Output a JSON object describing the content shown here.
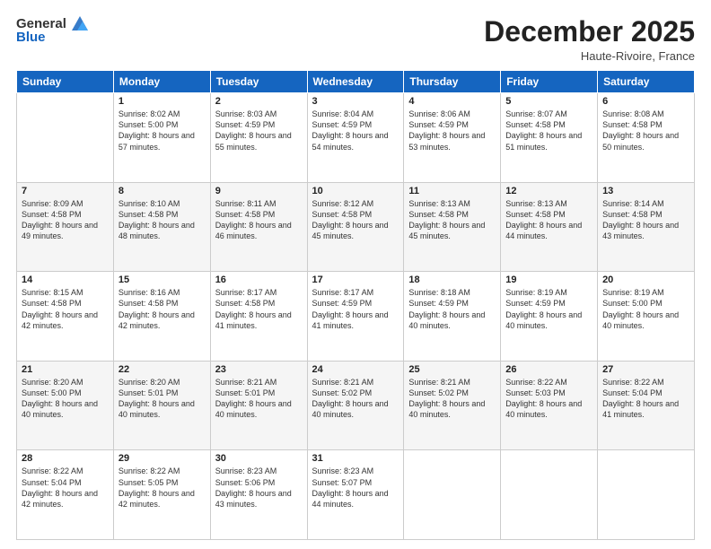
{
  "header": {
    "logo_general": "General",
    "logo_blue": "Blue",
    "month_title": "December 2025",
    "location": "Haute-Rivoire, France"
  },
  "weekdays": [
    "Sunday",
    "Monday",
    "Tuesday",
    "Wednesday",
    "Thursday",
    "Friday",
    "Saturday"
  ],
  "weeks": [
    [
      {
        "day": "",
        "sunrise": "",
        "sunset": "",
        "daylight": ""
      },
      {
        "day": "1",
        "sunrise": "Sunrise: 8:02 AM",
        "sunset": "Sunset: 5:00 PM",
        "daylight": "Daylight: 8 hours and 57 minutes."
      },
      {
        "day": "2",
        "sunrise": "Sunrise: 8:03 AM",
        "sunset": "Sunset: 4:59 PM",
        "daylight": "Daylight: 8 hours and 55 minutes."
      },
      {
        "day": "3",
        "sunrise": "Sunrise: 8:04 AM",
        "sunset": "Sunset: 4:59 PM",
        "daylight": "Daylight: 8 hours and 54 minutes."
      },
      {
        "day": "4",
        "sunrise": "Sunrise: 8:06 AM",
        "sunset": "Sunset: 4:59 PM",
        "daylight": "Daylight: 8 hours and 53 minutes."
      },
      {
        "day": "5",
        "sunrise": "Sunrise: 8:07 AM",
        "sunset": "Sunset: 4:58 PM",
        "daylight": "Daylight: 8 hours and 51 minutes."
      },
      {
        "day": "6",
        "sunrise": "Sunrise: 8:08 AM",
        "sunset": "Sunset: 4:58 PM",
        "daylight": "Daylight: 8 hours and 50 minutes."
      }
    ],
    [
      {
        "day": "7",
        "sunrise": "Sunrise: 8:09 AM",
        "sunset": "Sunset: 4:58 PM",
        "daylight": "Daylight: 8 hours and 49 minutes."
      },
      {
        "day": "8",
        "sunrise": "Sunrise: 8:10 AM",
        "sunset": "Sunset: 4:58 PM",
        "daylight": "Daylight: 8 hours and 48 minutes."
      },
      {
        "day": "9",
        "sunrise": "Sunrise: 8:11 AM",
        "sunset": "Sunset: 4:58 PM",
        "daylight": "Daylight: 8 hours and 46 minutes."
      },
      {
        "day": "10",
        "sunrise": "Sunrise: 8:12 AM",
        "sunset": "Sunset: 4:58 PM",
        "daylight": "Daylight: 8 hours and 45 minutes."
      },
      {
        "day": "11",
        "sunrise": "Sunrise: 8:13 AM",
        "sunset": "Sunset: 4:58 PM",
        "daylight": "Daylight: 8 hours and 45 minutes."
      },
      {
        "day": "12",
        "sunrise": "Sunrise: 8:13 AM",
        "sunset": "Sunset: 4:58 PM",
        "daylight": "Daylight: 8 hours and 44 minutes."
      },
      {
        "day": "13",
        "sunrise": "Sunrise: 8:14 AM",
        "sunset": "Sunset: 4:58 PM",
        "daylight": "Daylight: 8 hours and 43 minutes."
      }
    ],
    [
      {
        "day": "14",
        "sunrise": "Sunrise: 8:15 AM",
        "sunset": "Sunset: 4:58 PM",
        "daylight": "Daylight: 8 hours and 42 minutes."
      },
      {
        "day": "15",
        "sunrise": "Sunrise: 8:16 AM",
        "sunset": "Sunset: 4:58 PM",
        "daylight": "Daylight: 8 hours and 42 minutes."
      },
      {
        "day": "16",
        "sunrise": "Sunrise: 8:17 AM",
        "sunset": "Sunset: 4:58 PM",
        "daylight": "Daylight: 8 hours and 41 minutes."
      },
      {
        "day": "17",
        "sunrise": "Sunrise: 8:17 AM",
        "sunset": "Sunset: 4:59 PM",
        "daylight": "Daylight: 8 hours and 41 minutes."
      },
      {
        "day": "18",
        "sunrise": "Sunrise: 8:18 AM",
        "sunset": "Sunset: 4:59 PM",
        "daylight": "Daylight: 8 hours and 40 minutes."
      },
      {
        "day": "19",
        "sunrise": "Sunrise: 8:19 AM",
        "sunset": "Sunset: 4:59 PM",
        "daylight": "Daylight: 8 hours and 40 minutes."
      },
      {
        "day": "20",
        "sunrise": "Sunrise: 8:19 AM",
        "sunset": "Sunset: 5:00 PM",
        "daylight": "Daylight: 8 hours and 40 minutes."
      }
    ],
    [
      {
        "day": "21",
        "sunrise": "Sunrise: 8:20 AM",
        "sunset": "Sunset: 5:00 PM",
        "daylight": "Daylight: 8 hours and 40 minutes."
      },
      {
        "day": "22",
        "sunrise": "Sunrise: 8:20 AM",
        "sunset": "Sunset: 5:01 PM",
        "daylight": "Daylight: 8 hours and 40 minutes."
      },
      {
        "day": "23",
        "sunrise": "Sunrise: 8:21 AM",
        "sunset": "Sunset: 5:01 PM",
        "daylight": "Daylight: 8 hours and 40 minutes."
      },
      {
        "day": "24",
        "sunrise": "Sunrise: 8:21 AM",
        "sunset": "Sunset: 5:02 PM",
        "daylight": "Daylight: 8 hours and 40 minutes."
      },
      {
        "day": "25",
        "sunrise": "Sunrise: 8:21 AM",
        "sunset": "Sunset: 5:02 PM",
        "daylight": "Daylight: 8 hours and 40 minutes."
      },
      {
        "day": "26",
        "sunrise": "Sunrise: 8:22 AM",
        "sunset": "Sunset: 5:03 PM",
        "daylight": "Daylight: 8 hours and 40 minutes."
      },
      {
        "day": "27",
        "sunrise": "Sunrise: 8:22 AM",
        "sunset": "Sunset: 5:04 PM",
        "daylight": "Daylight: 8 hours and 41 minutes."
      }
    ],
    [
      {
        "day": "28",
        "sunrise": "Sunrise: 8:22 AM",
        "sunset": "Sunset: 5:04 PM",
        "daylight": "Daylight: 8 hours and 42 minutes."
      },
      {
        "day": "29",
        "sunrise": "Sunrise: 8:22 AM",
        "sunset": "Sunset: 5:05 PM",
        "daylight": "Daylight: 8 hours and 42 minutes."
      },
      {
        "day": "30",
        "sunrise": "Sunrise: 8:23 AM",
        "sunset": "Sunset: 5:06 PM",
        "daylight": "Daylight: 8 hours and 43 minutes."
      },
      {
        "day": "31",
        "sunrise": "Sunrise: 8:23 AM",
        "sunset": "Sunset: 5:07 PM",
        "daylight": "Daylight: 8 hours and 44 minutes."
      },
      {
        "day": "",
        "sunrise": "",
        "sunset": "",
        "daylight": ""
      },
      {
        "day": "",
        "sunrise": "",
        "sunset": "",
        "daylight": ""
      },
      {
        "day": "",
        "sunrise": "",
        "sunset": "",
        "daylight": ""
      }
    ]
  ]
}
